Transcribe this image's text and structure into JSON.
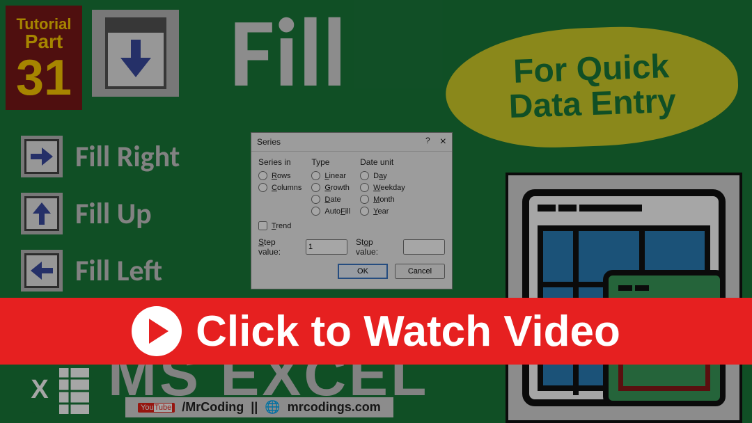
{
  "badge": {
    "line1": "Tutorial",
    "line2": "Part",
    "number": "31"
  },
  "title": "Fill",
  "blob": {
    "line1": "For Quick",
    "line2": "Data Entry"
  },
  "fillOptions": [
    {
      "label": "Fill Right",
      "dir": "right"
    },
    {
      "label": "Fill Up",
      "dir": "up"
    },
    {
      "label": "Fill Left",
      "dir": "left"
    }
  ],
  "dialog": {
    "title": "Series",
    "help": "?",
    "close": "×",
    "groups": {
      "seriesIn": {
        "head": "Series in",
        "options": [
          "Rows",
          "Columns"
        ]
      },
      "type": {
        "head": "Type",
        "options": [
          "Linear",
          "Growth",
          "Date",
          "AutoFill"
        ]
      },
      "dateUnit": {
        "head": "Date unit",
        "options": [
          "Day",
          "Weekday",
          "Month",
          "Year"
        ]
      }
    },
    "trend": "Trend",
    "stepLabel": "Step value:",
    "stepValue": "1",
    "stopLabel": "Stop value:",
    "stopValue": "",
    "ok": "OK",
    "cancel": "Cancel"
  },
  "msExcel": "MS EXCEL",
  "credits": {
    "youtube": "YouTube",
    "channel": "/MrCoding",
    "sep": "||",
    "site": "mrcodings.com"
  },
  "cta": "Click to Watch Video"
}
